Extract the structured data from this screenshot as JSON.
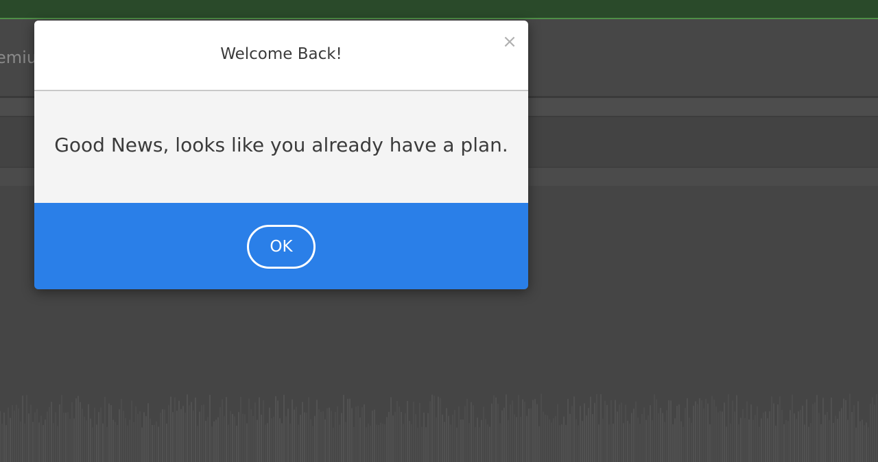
{
  "background": {
    "partial_label": "emiu",
    "accent_bar_color": "#2a4a2a",
    "accent_line_color": "#4f8f47"
  },
  "dialog": {
    "title": "Welcome Back!",
    "close_label": "×",
    "message": "Good News, looks like you already have a plan.",
    "ok_label": "OK",
    "footer_color": "#2a7fe8"
  }
}
